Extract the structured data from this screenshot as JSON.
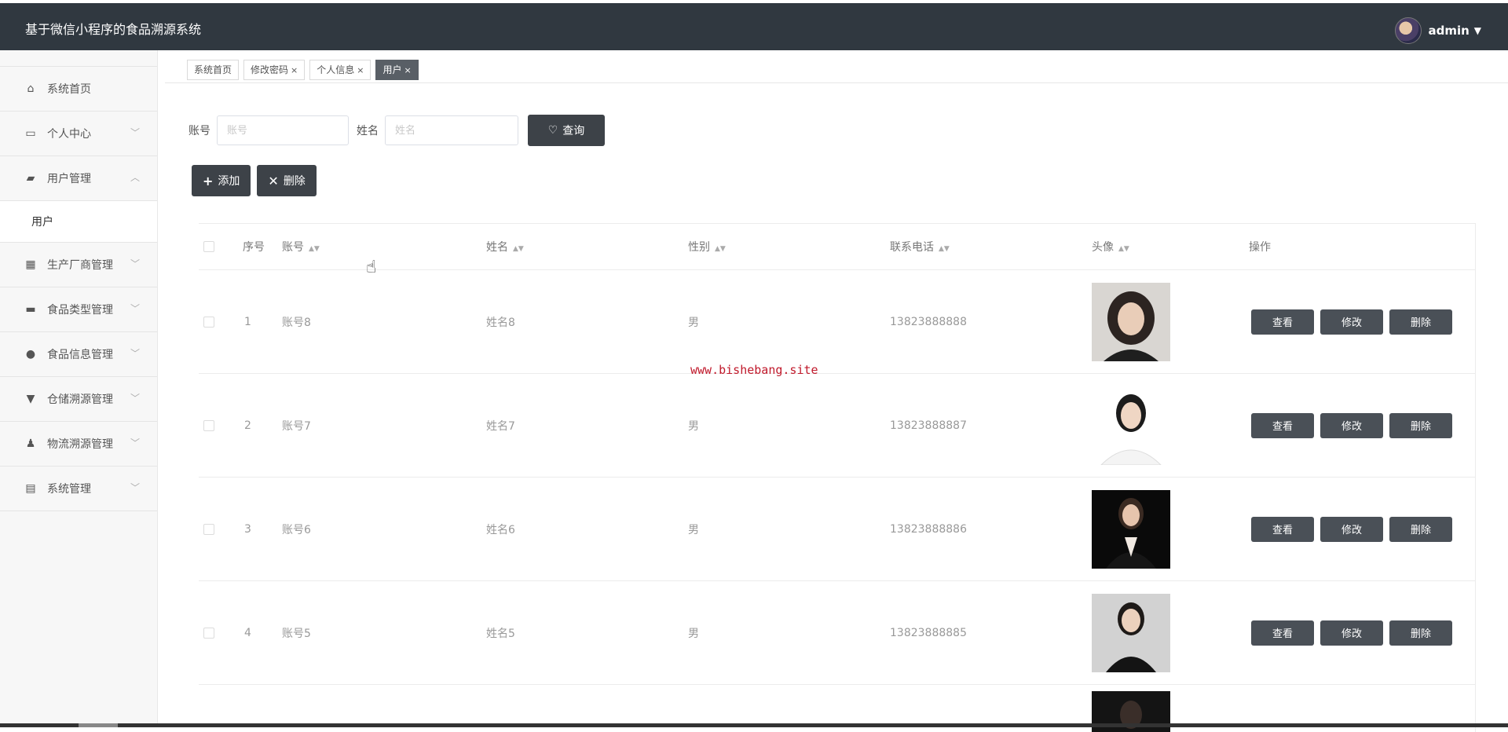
{
  "header": {
    "title": "基于微信小程序的食品溯源系统",
    "username": "admin"
  },
  "sidebar": {
    "items": [
      {
        "label": "系统首页",
        "icon": "home-icon"
      },
      {
        "label": "个人中心",
        "icon": "card-icon"
      },
      {
        "label": "用户管理",
        "icon": "user-manage-icon"
      },
      {
        "label": "生产厂商管理",
        "icon": "grid-icon"
      },
      {
        "label": "食品类型管理",
        "icon": "chat-icon"
      },
      {
        "label": "食品信息管理",
        "icon": "bulb-icon"
      },
      {
        "label": "仓储溯源管理",
        "icon": "storage-icon"
      },
      {
        "label": "物流溯源管理",
        "icon": "person-icon"
      },
      {
        "label": "系统管理",
        "icon": "clipboard-icon"
      }
    ],
    "sub_item": "用户"
  },
  "tabs": [
    {
      "label": "系统首页",
      "close": ""
    },
    {
      "label": "修改密码",
      "close": "×"
    },
    {
      "label": "个人信息",
      "close": "×"
    },
    {
      "label": "用户",
      "close": "×"
    }
  ],
  "search": {
    "account_label": "账号",
    "account_placeholder": "账号",
    "name_label": "姓名",
    "name_placeholder": "姓名",
    "query_button": "查询"
  },
  "actions": {
    "add": "添加",
    "delete": "删除"
  },
  "table": {
    "headers": [
      "序号",
      "账号",
      "姓名",
      "性别",
      "联系电话",
      "头像",
      "操作"
    ],
    "rows": [
      {
        "index": "1",
        "account": "账号8",
        "name": "姓名8",
        "gender": "男",
        "phone": "13823888888"
      },
      {
        "index": "2",
        "account": "账号7",
        "name": "姓名7",
        "gender": "男",
        "phone": "13823888887"
      },
      {
        "index": "3",
        "account": "账号6",
        "name": "姓名6",
        "gender": "男",
        "phone": "13823888886"
      },
      {
        "index": "4",
        "account": "账号5",
        "name": "姓名5",
        "gender": "男",
        "phone": "13823888885"
      }
    ],
    "op_labels": {
      "view": "查看",
      "edit": "修改",
      "delete": "删除"
    }
  },
  "watermark": "www.bishebang.site"
}
